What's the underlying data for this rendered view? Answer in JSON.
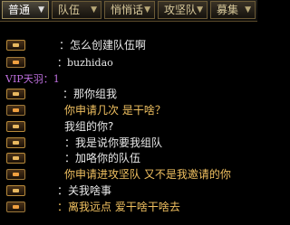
{
  "tabs": [
    {
      "label": "普通",
      "arrow": "▼",
      "active": true
    },
    {
      "label": "队伍",
      "arrow": "▼",
      "active": false
    },
    {
      "label": "悄悄话",
      "arrow": "▼",
      "active": false
    },
    {
      "label": "攻坚队",
      "arrow": "▼",
      "active": false
    },
    {
      "label": "募集",
      "arrow": "▼",
      "active": false
    }
  ],
  "messages": [
    {
      "badge": "badge-icon",
      "text": "：怎么创建队伍啊"
    },
    {
      "badge": "badge-icon",
      "text": "：buzhidao"
    },
    {
      "badge": null,
      "text": "VIP天羽：1"
    },
    {
      "badge": "badge-icon",
      "text": "：那你组我"
    },
    {
      "badge": "badge-icon",
      "text": "你申请几次   是干啥？"
    },
    {
      "badge": "badge-icon",
      "text": "我组的你?"
    },
    {
      "badge": "badge-icon",
      "text": "：我是说你要我组队"
    },
    {
      "badge": "badge-icon",
      "text": "：加咯你的队伍"
    },
    {
      "badge": "badge-icon",
      "text": "你申请进攻坚队    又不是我邀请的你"
    },
    {
      "badge": "badge-icon",
      "text": "：关我啥事"
    },
    {
      "badge": "badge-icon",
      "text": "：离我远点   爱干啥干啥去"
    }
  ],
  "colors": {
    "tab_text": "#d8c99b",
    "tab_active_text": "#ffffff",
    "message_white": "#e8e8e8",
    "message_gold": "#f0c060",
    "vip_purple": "#c070e0"
  }
}
